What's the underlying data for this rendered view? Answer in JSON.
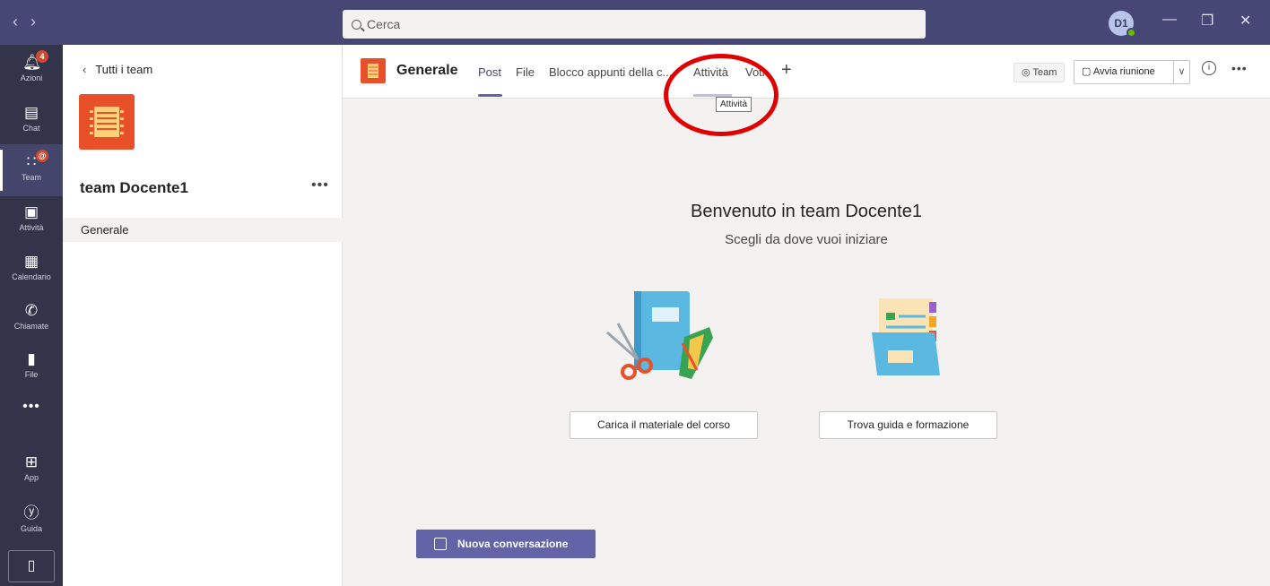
{
  "titlebar": {
    "search_placeholder": "Cerca",
    "avatar_initials": "D1",
    "presence_color": "#6bb700"
  },
  "rail": {
    "items": [
      {
        "label": "Azioni",
        "icon": "bell-icon",
        "badge": "4"
      },
      {
        "label": "Chat",
        "icon": "chat-icon"
      },
      {
        "label": "Team",
        "icon": "team-icon",
        "badge": "@",
        "active": true
      },
      {
        "label": "Attività",
        "icon": "assignments-icon"
      },
      {
        "label": "Calendario",
        "icon": "calendar-icon"
      },
      {
        "label": "Chiamate",
        "icon": "phone-icon"
      },
      {
        "label": "File",
        "icon": "file-icon"
      },
      {
        "label": "App",
        "icon": "apps-icon"
      },
      {
        "label": "Guida",
        "icon": "help-icon"
      }
    ]
  },
  "team_panel": {
    "back_label": "Tutti i team",
    "team_name": "team Docente1",
    "channels": [
      "Generale"
    ]
  },
  "channel_header": {
    "title": "Generale",
    "tabs": [
      "Post",
      "File",
      "Blocco appunti della c...",
      "Attività",
      "Voti"
    ],
    "active_tab": "Post",
    "tooltip": "Attività",
    "team_pill": "Team",
    "meet_button": "Avvia riunione"
  },
  "main": {
    "welcome": "Benvenuto in team Docente1",
    "subtitle": "Scegli da dove vuoi iniziare",
    "upload_button": "Carica il materiale del corso",
    "guide_button": "Trova guida e formazione",
    "new_conversation": "Nuova conversazione"
  },
  "colors": {
    "titlebar": "#464775",
    "rail": "#33344a",
    "accent": "#6264a7",
    "annotation": "#e00000"
  }
}
